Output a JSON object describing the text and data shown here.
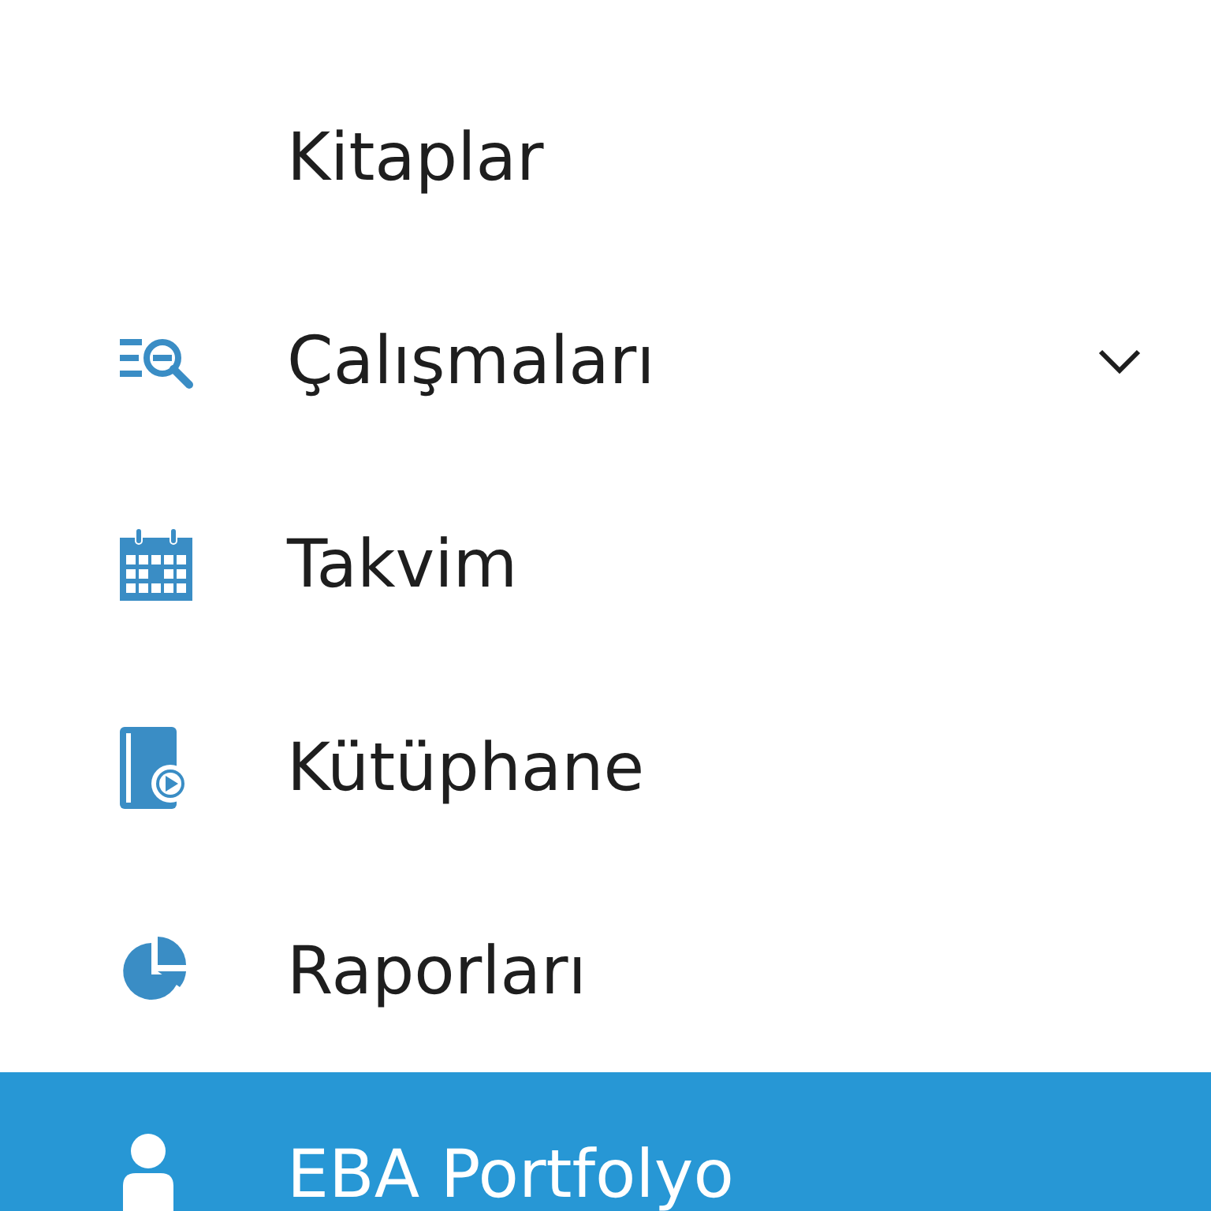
{
  "menu": {
    "items": [
      {
        "label": "Kitaplar",
        "kind": "none",
        "selected": false
      },
      {
        "label": "Çalışmaları",
        "kind": "search",
        "selected": false,
        "expanded": false
      },
      {
        "label": "Takvim",
        "kind": "calendar",
        "selected": false
      },
      {
        "label": "Kütüphane",
        "kind": "library",
        "selected": false
      },
      {
        "label": "Raporları",
        "kind": "reports",
        "selected": false
      },
      {
        "label": "EBA Portfolyo",
        "kind": "profile",
        "selected": true
      }
    ]
  }
}
